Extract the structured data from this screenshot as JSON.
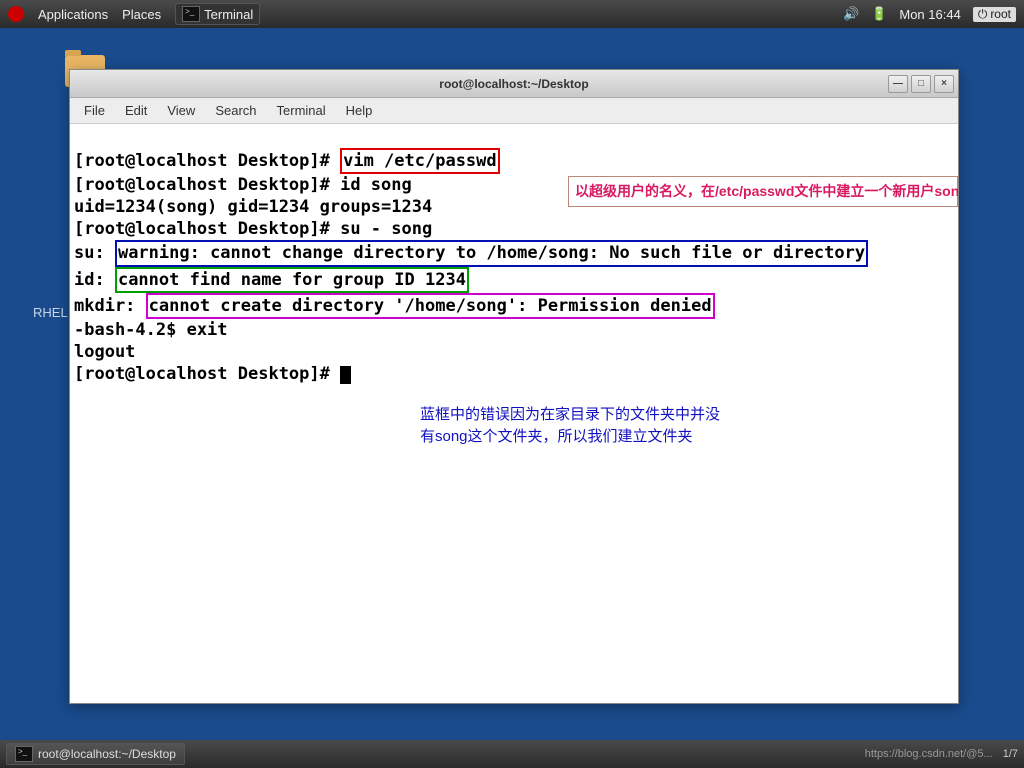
{
  "panel": {
    "applications": "Applications",
    "places": "Places",
    "terminal_task": "Terminal",
    "clock": "Mon 16:44",
    "user": "root"
  },
  "rhel_label": "RHEL",
  "window": {
    "title": "root@localhost:~/Desktop",
    "minimize": "—",
    "maximize": "□",
    "close": "×"
  },
  "menu": {
    "file": "File",
    "edit": "Edit",
    "view": "View",
    "search": "Search",
    "terminal": "Terminal",
    "help": "Help"
  },
  "term": {
    "p1": "[root@localhost Desktop]# ",
    "cmd1": "vim /etc/passwd",
    "l2": "[root@localhost Desktop]# id song",
    "l3": "uid=1234(song) gid=1234 groups=1234",
    "l4": "[root@localhost Desktop]# su - song",
    "l5a": "su: ",
    "l5b": "warning: cannot change directory to /home/song: No such file or directory",
    "l6a": "id: ",
    "l6b": "cannot find name for group ID 1234",
    "l7a": "mkdir: ",
    "l7b": "cannot create directory '/home/song': Permission denied",
    "l8": "-bash-4.2$ exit",
    "l9": "logout",
    "l10": "[root@localhost Desktop]# "
  },
  "anno_red": "以超级用户的名义，在/etc/passwd文件中建立一个新用户song，查看song的id用户id存在，但是组id，与附加组id中的组都不存在。所以当我们切换用户时，会出现以下的绿框中的错误 所以我们建组",
  "anno_blue_l1": "蓝框中的错误因为在家目录下的文件夹中并没",
  "anno_blue_l2": "有song这个文件夹，所以我们建立文件夹",
  "bottom": {
    "task": "root@localhost:~/Desktop",
    "watermark": "https://blog.csdn.net/@5...",
    "page": "1/7"
  }
}
